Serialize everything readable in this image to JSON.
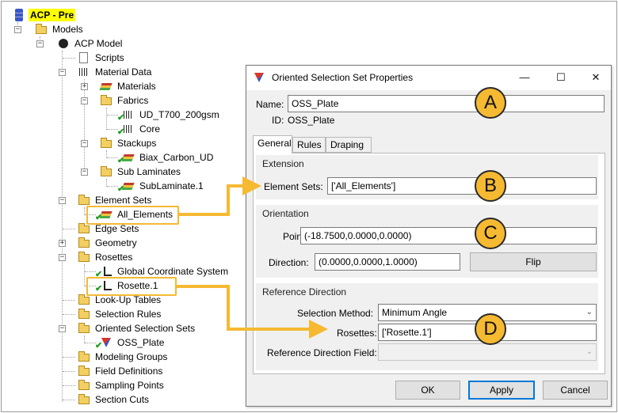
{
  "tree": {
    "root": "ACP - Pre",
    "models": "Models",
    "acp_model": "ACP Model",
    "scripts": "Scripts",
    "material_data": "Material Data",
    "materials": "Materials",
    "fabrics": "Fabrics",
    "fabric_1": "UD_T700_200gsm",
    "fabric_2": "Core",
    "stackups": "Stackups",
    "stackup_1": "Biax_Carbon_UD",
    "sub_laminates": "Sub Laminates",
    "sub_laminate_1": "SubLaminate.1",
    "element_sets": "Element Sets",
    "element_set_1": "All_Elements",
    "edge_sets": "Edge Sets",
    "geometry": "Geometry",
    "rosettes": "Rosettes",
    "rosette_gcs": "Global Coordinate System",
    "rosette_1": "Rosette.1",
    "lookup_tables": "Look-Up Tables",
    "selection_rules": "Selection Rules",
    "oss": "Oriented Selection Sets",
    "oss_1": "OSS_Plate",
    "modeling_groups": "Modeling Groups",
    "field_definitions": "Field Definitions",
    "sampling_points": "Sampling Points",
    "section_cuts": "Section Cuts"
  },
  "dialog": {
    "title": "Oriented Selection Set Properties",
    "minimize": "—",
    "maximize": "☐",
    "close": "✕",
    "name_label": "Name:",
    "name_value": "OSS_Plate",
    "id_label": "ID:",
    "id_value": "OSS_Plate",
    "tabs": [
      "General",
      "Rules",
      "Draping"
    ],
    "extension_title": "Extension",
    "element_sets_label": "Element Sets:",
    "element_sets_value": "['All_Elements']",
    "orientation_title": "Orientation",
    "point_label": "Point:",
    "point_value": "(-18.7500,0.0000,0.0000)",
    "direction_label": "Direction:",
    "direction_value": "(0.0000,0.0000,1.0000)",
    "flip_label": "Flip",
    "refdir_title": "Reference Direction",
    "selection_method_label": "Selection Method:",
    "selection_method_value": "Minimum Angle",
    "rosettes_label": "Rosettes:",
    "rosettes_value": "['Rosette.1']",
    "refdir_field_label": "Reference Direction Field:",
    "refdir_field_value": "",
    "ok": "OK",
    "apply": "Apply",
    "cancel": "Cancel"
  },
  "callouts": [
    "A",
    "B",
    "C",
    "D"
  ],
  "colors": {
    "highlight": "#f5b932",
    "root_highlight": "#ffff00",
    "check_green": "#1b9e1b",
    "primary_button_border": "#0078d7"
  }
}
